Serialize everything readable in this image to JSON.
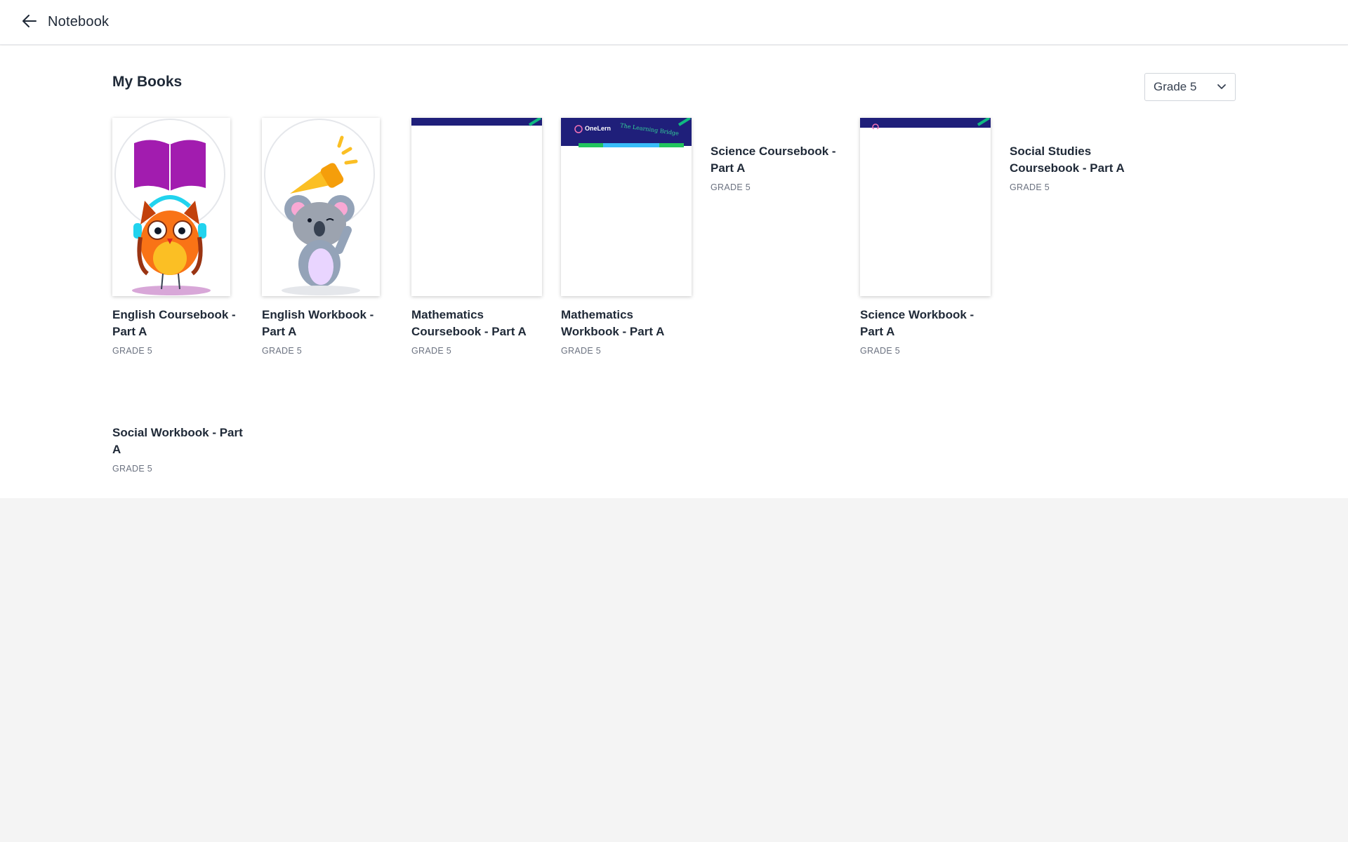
{
  "header": {
    "title": "Notebook",
    "back_icon": "arrow-left-icon"
  },
  "main": {
    "section_title": "My Books",
    "grade_filter": {
      "selected": "Grade 5",
      "icon": "chevron-down-icon"
    },
    "books": [
      {
        "title": "English Coursebook - Part A",
        "grade": "GRADE 5",
        "cover": "owl-illustration"
      },
      {
        "title": "English Workbook - Part A",
        "grade": "GRADE 5",
        "cover": "koala-illustration"
      },
      {
        "title": "Mathematics Coursebook - Part A",
        "grade": "GRADE 5",
        "cover": "onelern-cover-loading"
      },
      {
        "title": "Mathematics Workbook - Part A",
        "grade": "GRADE 5",
        "cover": "onelern-cover-loading",
        "cover_brand": "OneLern",
        "cover_tagline": "The Learning Bridge"
      },
      {
        "title": "Science Coursebook - Part A",
        "grade": "GRADE 5",
        "cover": "none"
      },
      {
        "title": "Science Workbook - Part A",
        "grade": "GRADE 5",
        "cover": "onelern-cover-loading"
      },
      {
        "title": "Social Studies Coursebook - Part A",
        "grade": "GRADE 5",
        "cover": "none"
      },
      {
        "title": "Social Workbook - Part A",
        "grade": "GRADE 5",
        "cover": "none"
      }
    ]
  },
  "colors": {
    "cover_band": "#1f1f7a",
    "cover_accent": "#10b981",
    "page_background": "#f4f4f4"
  }
}
